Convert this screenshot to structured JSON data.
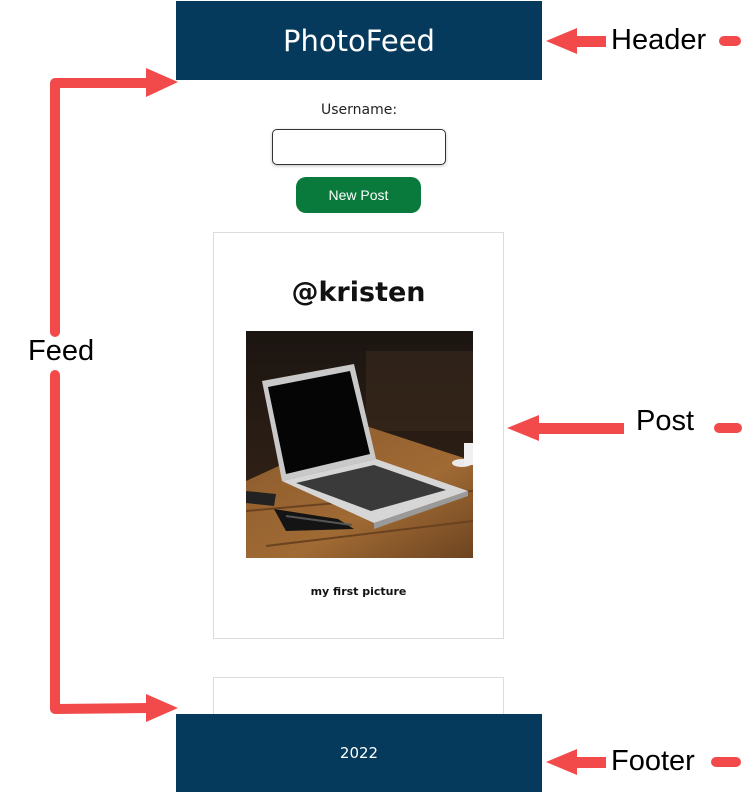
{
  "header": {
    "title": "PhotoFeed"
  },
  "form": {
    "username_label": "Username:",
    "username_value": "",
    "new_post_label": "New Post"
  },
  "post": {
    "username": "@kristen",
    "caption": "my first picture",
    "image_icon": "laptop-photo"
  },
  "footer": {
    "text": "2022"
  },
  "annotations": {
    "header": "Header",
    "feed": "Feed",
    "post": "Post",
    "footer": "Footer"
  },
  "colors": {
    "header_bg": "#063a5c",
    "footer_bg": "#063a5c",
    "button_bg": "#0a7a3c",
    "annotation_arrow": "#f24a4a"
  }
}
